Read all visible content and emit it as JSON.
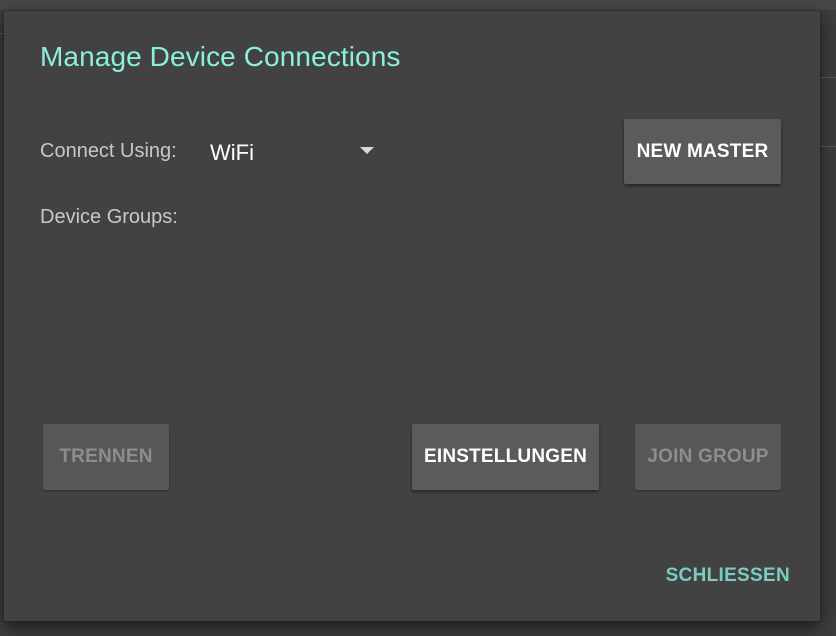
{
  "dialog": {
    "title": "Manage Device Connections",
    "connect_using": {
      "label": "Connect Using:",
      "selected_value": "WiFi",
      "dropdown_icon": "caret-down-icon"
    },
    "device_groups_label": "Device Groups:",
    "buttons": {
      "new_master": "NEW MASTER",
      "trennen": "TRENNEN",
      "einstellungen": "EINSTELLUNGEN",
      "join_group": "JOIN GROUP",
      "schliessen": "SCHLIESSEN"
    },
    "disabled": {
      "trennen": true,
      "join_group": true
    }
  },
  "colors": {
    "title": "#8af0dc",
    "accent_text_button": "#79ccbf",
    "dialog_background": "#424242",
    "button_background": "#5b5b5b",
    "disabled_text": "#8d8d8d"
  }
}
